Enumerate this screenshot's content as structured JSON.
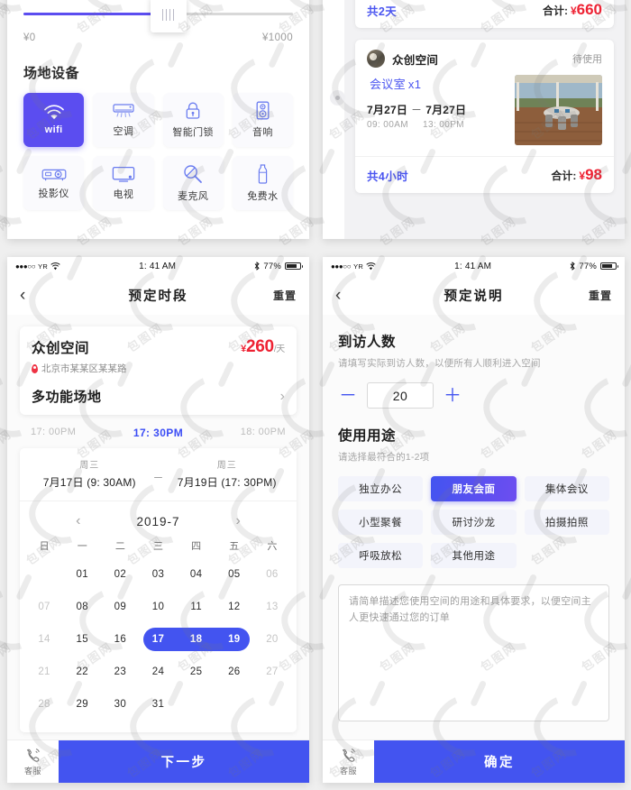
{
  "filter_panel": {
    "price_slider": {
      "min_label": "¥0",
      "max_label": "¥1000",
      "fill_percent": 53
    },
    "facilities_title": "场地设备",
    "facilities": [
      {
        "label": "wifi",
        "icon": "wifi-icon",
        "selected": true
      },
      {
        "label": "空调",
        "icon": "air-conditioner-icon",
        "selected": false
      },
      {
        "label": "智能门锁",
        "icon": "smart-lock-icon",
        "selected": false
      },
      {
        "label": "音响",
        "icon": "speaker-icon",
        "selected": false
      },
      {
        "label": "投影仪",
        "icon": "projector-icon",
        "selected": false
      },
      {
        "label": "电视",
        "icon": "tv-icon",
        "selected": false
      },
      {
        "label": "麦克风",
        "icon": "microphone-icon",
        "selected": false
      },
      {
        "label": "免费水",
        "icon": "water-bottle-icon",
        "selected": false
      }
    ]
  },
  "orders_panel": {
    "first_card_footer": {
      "duration": "共2天",
      "total_label": "合计:",
      "currency": "¥",
      "amount": "660"
    },
    "second_card": {
      "venue": "众创空间",
      "status": "待使用",
      "room": "会议室",
      "quantity": "x1",
      "start_date": "7月27日",
      "dash": "－",
      "end_date": "7月27日",
      "start_time": "09: 00AM",
      "end_time": "13: 00PM",
      "footer": {
        "duration": "共4小时",
        "total_label": "合计:",
        "currency": "¥",
        "amount": "98"
      }
    }
  },
  "statusbar": {
    "signal_dots": "●●●○○",
    "carrier": "YR",
    "wifi_icon": "wifi-icon",
    "time": "1: 41 AM",
    "bluetooth_icon": "bluetooth-icon",
    "battery_percent": "77%"
  },
  "booking_screen": {
    "nav": {
      "back_icon": "chevron-left-icon",
      "title": "预定时段",
      "right_action": "重置"
    },
    "venue": {
      "name": "众创空间",
      "address": "北京市某某区某某路",
      "address_icon": "location-pin-icon",
      "currency": "¥",
      "price": "260",
      "unit": "/天",
      "room_type": "多功能场地",
      "chevron_icon": "chevron-right-icon"
    },
    "timescale": [
      {
        "label": "17: 00PM",
        "current": false
      },
      {
        "label": "17: 30PM",
        "current": true
      },
      {
        "label": "18: 00PM",
        "current": false
      }
    ],
    "range": {
      "start_weekday": "周三",
      "start_date": "7月17日 (9: 30AM)",
      "separator": "－",
      "end_weekday": "周三",
      "end_date": "7月19日 (17: 30PM)"
    },
    "calendar": {
      "prev_icon": "chevron-left-icon",
      "month_label": "2019-7",
      "next_icon": "chevron-right-icon",
      "weekday_headers": [
        "日",
        "一",
        "二",
        "三",
        "四",
        "五",
        "六"
      ],
      "weeks": [
        [
          {
            "t": "",
            "s": "empty"
          },
          {
            "t": "01",
            "s": "normal"
          },
          {
            "t": "02",
            "s": "normal"
          },
          {
            "t": "03",
            "s": "normal"
          },
          {
            "t": "04",
            "s": "normal"
          },
          {
            "t": "05",
            "s": "normal"
          },
          {
            "t": "06",
            "s": "dim"
          }
        ],
        [
          {
            "t": "07",
            "s": "dim"
          },
          {
            "t": "08",
            "s": "normal"
          },
          {
            "t": "09",
            "s": "normal"
          },
          {
            "t": "10",
            "s": "normal"
          },
          {
            "t": "11",
            "s": "normal"
          },
          {
            "t": "12",
            "s": "normal"
          },
          {
            "t": "13",
            "s": "dim"
          }
        ],
        [
          {
            "t": "14",
            "s": "dim"
          },
          {
            "t": "15",
            "s": "normal"
          },
          {
            "t": "16",
            "s": "normal"
          },
          {
            "t": "17",
            "s": "sel"
          },
          {
            "t": "18",
            "s": "sel"
          },
          {
            "t": "19",
            "s": "sel"
          },
          {
            "t": "20",
            "s": "dim"
          }
        ],
        [
          {
            "t": "21",
            "s": "dim"
          },
          {
            "t": "22",
            "s": "normal"
          },
          {
            "t": "23",
            "s": "normal"
          },
          {
            "t": "24",
            "s": "normal"
          },
          {
            "t": "25",
            "s": "normal"
          },
          {
            "t": "26",
            "s": "normal"
          },
          {
            "t": "27",
            "s": "dim"
          }
        ],
        [
          {
            "t": "28",
            "s": "dim"
          },
          {
            "t": "29",
            "s": "normal"
          },
          {
            "t": "30",
            "s": "normal"
          },
          {
            "t": "31",
            "s": "normal"
          },
          {
            "t": "",
            "s": "empty"
          },
          {
            "t": "",
            "s": "empty"
          },
          {
            "t": "",
            "s": "empty"
          }
        ]
      ],
      "selected_range": [
        17,
        19
      ]
    },
    "tabbar": {
      "service_icon": "phone-ring-icon",
      "service_label": "客服",
      "primary_label": "下一步"
    }
  },
  "description_screen": {
    "nav": {
      "back_icon": "chevron-left-icon",
      "title": "预定说明",
      "right_action": "重置"
    },
    "visitors": {
      "title": "到访人数",
      "subtitle": "请填写实际到访人数，以便所有人顺利进入空间",
      "minus_label": "－",
      "value": "20",
      "plus_label": "＋"
    },
    "purpose": {
      "title": "使用用途",
      "subtitle": "请选择最符合的1-2项",
      "tags": [
        {
          "label": "独立办公",
          "selected": false
        },
        {
          "label": "朋友会面",
          "selected": true
        },
        {
          "label": "集体会议",
          "selected": false
        },
        {
          "label": "小型聚餐",
          "selected": false
        },
        {
          "label": "研讨沙龙",
          "selected": false
        },
        {
          "label": "拍摄拍照",
          "selected": false
        },
        {
          "label": "呼吸放松",
          "selected": false
        },
        {
          "label": "其他用途",
          "selected": false
        }
      ]
    },
    "memo": {
      "placeholder": "请简单描述您使用空间的用途和具体要求，以便空间主人更快速通过您的订单"
    },
    "tabbar": {
      "service_icon": "phone-ring-icon",
      "service_label": "客服",
      "primary_label": "确定"
    }
  },
  "theme": {
    "primary": "#4354f0",
    "purple": "#5b4df0",
    "danger": "#ee2233",
    "page_bg": "#efefef"
  },
  "watermark": {
    "text": "包图网"
  }
}
